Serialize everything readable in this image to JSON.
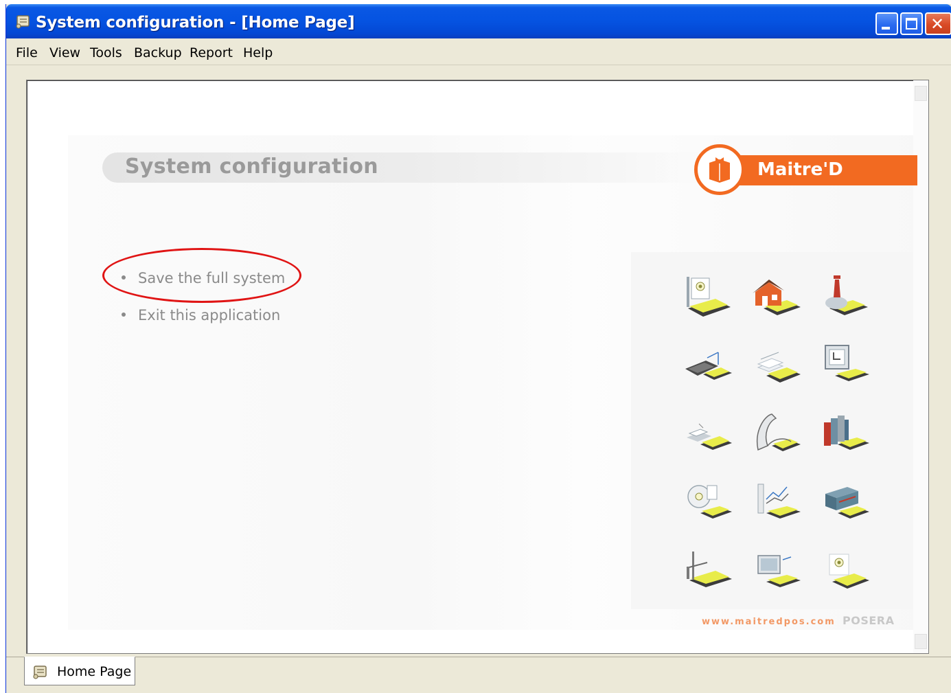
{
  "window": {
    "title": "System configuration - [Home Page]",
    "icon": "scroll-app-icon",
    "controls": [
      "minimize",
      "maximize",
      "close"
    ],
    "close_glyph": "✕"
  },
  "menu": {
    "items": [
      "File",
      "View",
      "Tools",
      "Backup",
      "Report",
      "Help"
    ]
  },
  "page": {
    "title": "System configuration",
    "brand": "Maitre'D",
    "brand_color": "#f26a21",
    "links": [
      "Save the full system",
      "Exit this application"
    ],
    "highlighted_link": "Save the full system",
    "highlight_color": "#e01414",
    "icons": [
      "certificate-icon",
      "house-icon",
      "flask-icon",
      "laptop-icon",
      "document-stack-icon",
      "monitor-icon",
      "printer-icon",
      "curved-paper-icon",
      "books-icon",
      "disc-icon",
      "chart-icon",
      "server-icon",
      "network-tower-icon",
      "screen-icon",
      "badge-icon"
    ],
    "icon_accent_color": "#e8ec4a",
    "footer_url": "www.maitredpos.com",
    "footer_brand": "POSERA"
  },
  "tabs": [
    {
      "label": "Home Page",
      "icon": "scroll-app-icon",
      "active": true
    }
  ]
}
